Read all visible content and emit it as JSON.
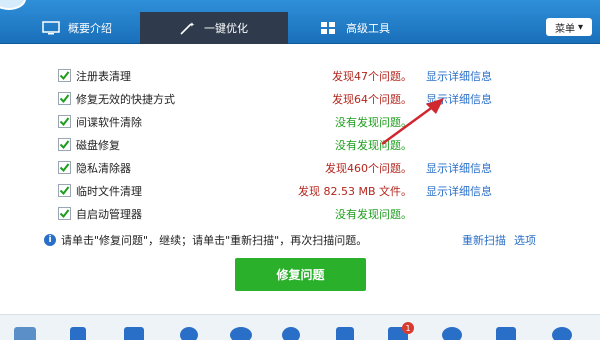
{
  "nav": {
    "tab_overview": "概要介绍",
    "tab_optimize": "一键优化",
    "tab_advanced": "高级工具",
    "menu_label": "菜单"
  },
  "scan": {
    "items": [
      {
        "label": "注册表清理",
        "status": "发现47个问题。",
        "status_color": "red",
        "link": "显示详细信息"
      },
      {
        "label": "修复无效的快捷方式",
        "status": "发现64个问题。",
        "status_color": "red",
        "link": "显示详细信息"
      },
      {
        "label": "间谍软件清除",
        "status": "没有发现问题。",
        "status_color": "green",
        "link": ""
      },
      {
        "label": "磁盘修复",
        "status": "没有发现问题。",
        "status_color": "green",
        "link": ""
      },
      {
        "label": "隐私清除器",
        "status": "发现460个问题。",
        "status_color": "red",
        "link": "显示详细信息"
      },
      {
        "label": "临时文件清理",
        "status": "发现 82.53 MB 文件。",
        "status_color": "red",
        "link": "显示详细信息"
      },
      {
        "label": "自启动管理器",
        "status": "没有发现问题。",
        "status_color": "green",
        "link": ""
      }
    ],
    "info_text": "请单击\"修复问题\"，继续；请单击\"重新扫描\"，再次扫描问题。",
    "rescan_label": "重新扫描",
    "options_label": "选项",
    "fix_button": "修复问题"
  },
  "bottom": {
    "badge_count": "1"
  },
  "colors": {
    "nav_blue": "#2f8fd9",
    "active_tab": "#2f3b4d",
    "fix_green": "#2bb02b",
    "status_red": "#b3261e",
    "status_green": "#1e9d1e",
    "link_blue": "#2a6fc7",
    "annotation_arrow": "#d0282e"
  }
}
